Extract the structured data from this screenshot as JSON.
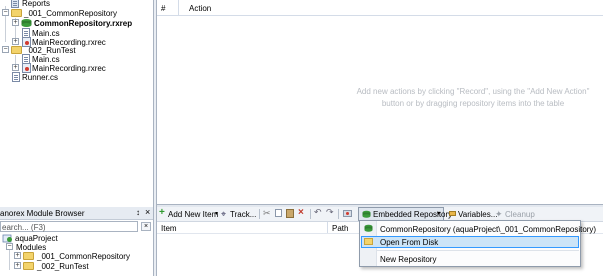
{
  "project_tree": {
    "items": [
      {
        "label": "Reports"
      },
      {
        "label": "_001_CommonRepository"
      },
      {
        "label": "CommonRepository.rxrep"
      },
      {
        "label": "Main.cs"
      },
      {
        "label": "MainRecording.rxrec"
      },
      {
        "label": "_002_RunTest"
      },
      {
        "label": "Main.cs"
      },
      {
        "label": "MainRecording.rxrec"
      },
      {
        "label": "Runner.cs"
      }
    ]
  },
  "actions_table": {
    "col_num": "#",
    "col_action": "Action",
    "empty_message_line1": "Add new actions by clicking \"Record\", using the \"Add New Action\"",
    "empty_message_line2": "button or by dragging repository items into the table"
  },
  "module_browser": {
    "title": "anorex Module Browser",
    "pin": "↕",
    "close": "×",
    "search_value": "earch... (F3)",
    "items": [
      {
        "label": "aquaProject"
      },
      {
        "label": "Modules"
      },
      {
        "label": "_001_CommonRepository"
      },
      {
        "label": "_002_RunTest"
      }
    ]
  },
  "toolbar": {
    "add_new_item": "Add New Item",
    "track": "Track...",
    "embedded_repository": "Embedded Repository",
    "variables": "Variables...",
    "cleanup": "Cleanup"
  },
  "repo_table": {
    "col_item": "Item",
    "col_path": "Path"
  },
  "dropdown": {
    "items": [
      {
        "label": "CommonRepository (aquaProject\\_001_CommonRepository)"
      },
      {
        "label": "Open From Disk"
      },
      {
        "label": "New Repository"
      }
    ]
  },
  "colors": {
    "accent": "#3399ff",
    "selected_bg": "#cce4f7",
    "panel_border": "#a9b3c1",
    "separator": "#d4dce8"
  }
}
